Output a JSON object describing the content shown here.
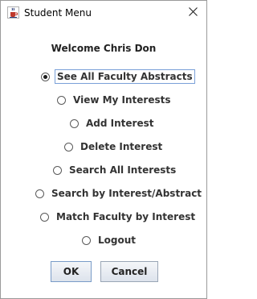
{
  "window": {
    "title": "Student Menu",
    "close_glyph": "✕"
  },
  "welcome_text": "Welcome Chris Don",
  "options": [
    {
      "label": "See All Faculty Abstracts",
      "selected": true
    },
    {
      "label": "View My Interests",
      "selected": false
    },
    {
      "label": "Add Interest",
      "selected": false
    },
    {
      "label": "Delete Interest",
      "selected": false
    },
    {
      "label": "Search All Interests",
      "selected": false
    },
    {
      "label": "Search by Interest/Abstract",
      "selected": false
    },
    {
      "label": "Match Faculty by Interest",
      "selected": false
    },
    {
      "label": "Logout",
      "selected": false
    }
  ],
  "buttons": {
    "ok_label": "OK",
    "cancel_label": "Cancel"
  },
  "icons": {
    "app": "java-cup-icon",
    "close": "close-icon"
  }
}
